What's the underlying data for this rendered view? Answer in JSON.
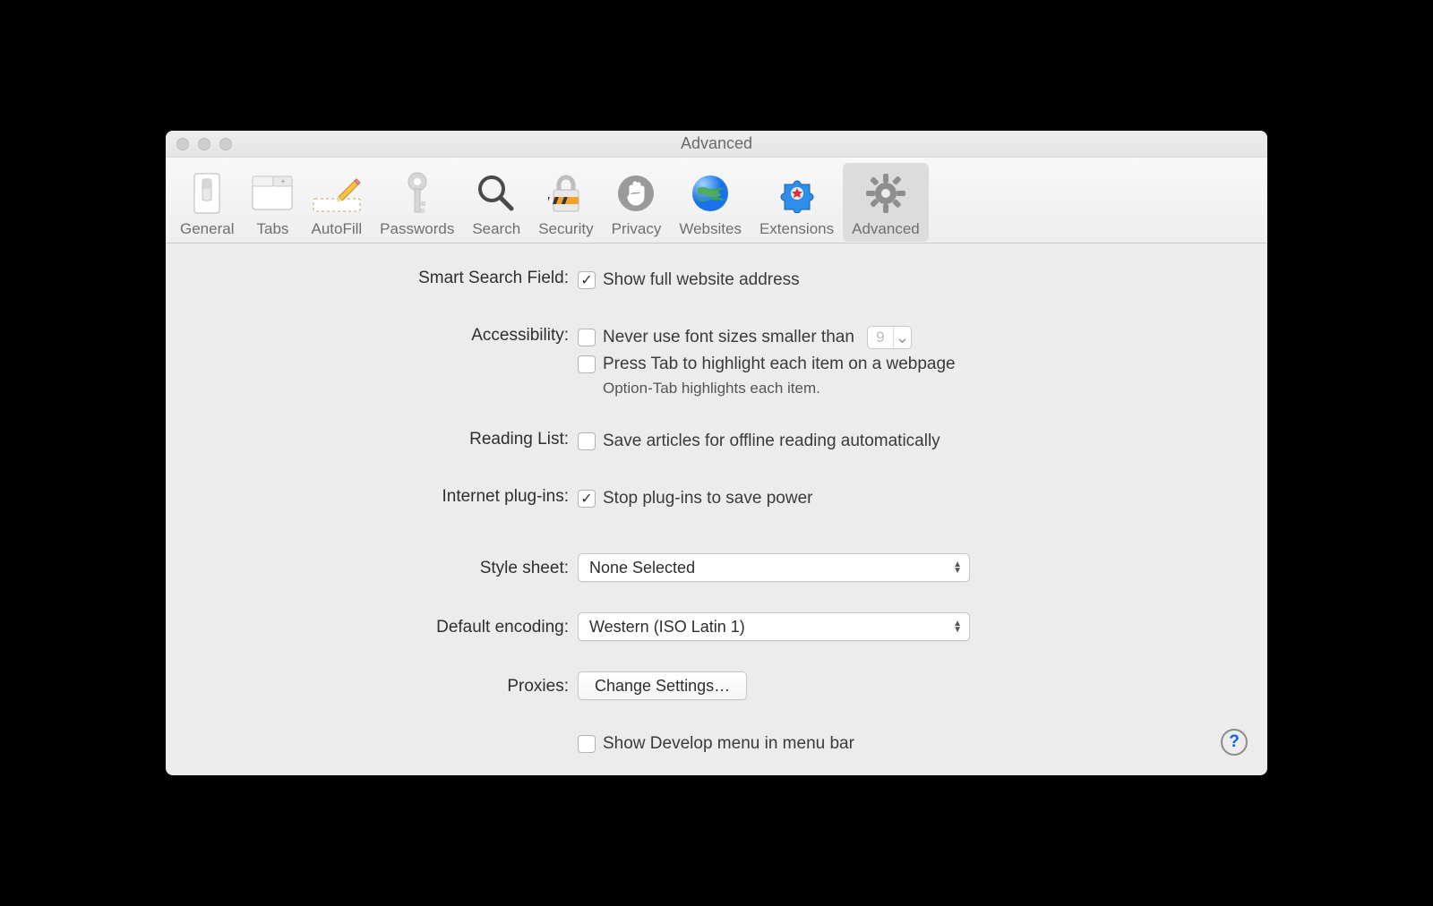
{
  "window": {
    "title": "Advanced"
  },
  "tabs": [
    {
      "label": "General"
    },
    {
      "label": "Tabs"
    },
    {
      "label": "AutoFill"
    },
    {
      "label": "Passwords"
    },
    {
      "label": "Search"
    },
    {
      "label": "Security"
    },
    {
      "label": "Privacy"
    },
    {
      "label": "Websites"
    },
    {
      "label": "Extensions"
    },
    {
      "label": "Advanced"
    }
  ],
  "sections": {
    "smartSearch": {
      "label": "Smart Search Field:",
      "showFull": "Show full website address"
    },
    "accessibility": {
      "label": "Accessibility:",
      "neverSmaller": "Never use font sizes smaller than",
      "fontSizeValue": "9",
      "pressTab": "Press Tab to highlight each item on a webpage",
      "note": "Option-Tab highlights each item."
    },
    "readingList": {
      "label": "Reading List:",
      "saveOffline": "Save articles for offline reading automatically"
    },
    "plugins": {
      "label": "Internet plug-ins:",
      "stopPlugins": "Stop plug-ins to save power"
    },
    "stylesheet": {
      "label": "Style sheet:",
      "value": "None Selected"
    },
    "encoding": {
      "label": "Default encoding:",
      "value": "Western (ISO Latin 1)"
    },
    "proxies": {
      "label": "Proxies:",
      "button": "Change Settings…"
    },
    "develop": {
      "label": "Show Develop menu in menu bar"
    }
  },
  "help": "?"
}
